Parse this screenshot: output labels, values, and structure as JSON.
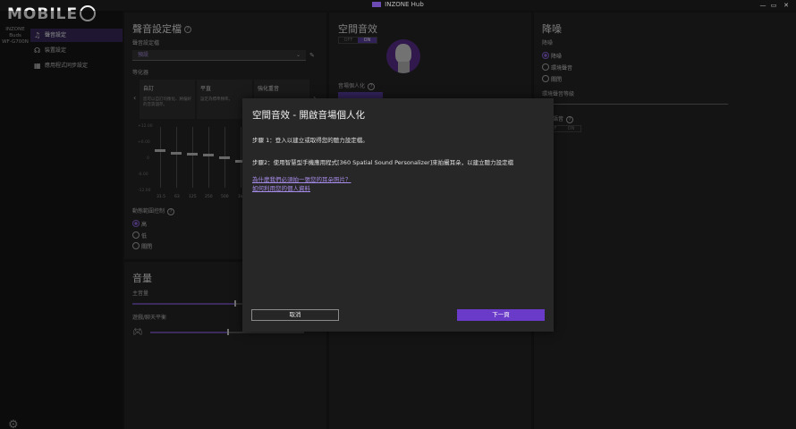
{
  "watermark": {
    "text": "MOBILE"
  },
  "titlebar": {
    "app_name": "INZONE Hub",
    "min": "—",
    "max": "▭",
    "close": "✕"
  },
  "sidebar": {
    "device_line1": "INZONE Buds",
    "device_line2": "WF-G700N",
    "items": [
      {
        "label": "聲音設定",
        "icon": "♫"
      },
      {
        "label": "裝置設定",
        "icon": "☊"
      },
      {
        "label": "應用程式同步設定",
        "icon": "▦"
      }
    ],
    "settings_icon": "⚙"
  },
  "sound": {
    "title": "聲音設定檔",
    "profile_label": "聲音設定檔",
    "profile_value": "預設",
    "eq_label": "等化器",
    "cards": [
      {
        "title": "自訂",
        "desc": "您可以自訂均衡化、將偏好的音質儲存。"
      },
      {
        "title": "平直",
        "desc": "設定為標準頻率。"
      },
      {
        "title": "強化重音",
        "desc": ""
      }
    ],
    "axis": [
      "+12.00",
      "+6.00",
      "0",
      "-6.00",
      "-12.00"
    ],
    "freqs": [
      "31.5",
      "63",
      "125",
      "250",
      "500",
      "1k"
    ],
    "dynamic_label": "動態範圍控制",
    "dynamic_options": [
      "高",
      "低",
      "關閉"
    ],
    "dynamic_selected": 0
  },
  "volume": {
    "title": "音量",
    "master_label": "主音量",
    "balance_label": "遊戲/聊天平衡",
    "master_level_pct": 55,
    "balance_level_pct": 50
  },
  "spatial": {
    "title": "空間音效",
    "off": "OFF",
    "on": "ON",
    "personalize_label": "音場個人化"
  },
  "nc": {
    "title": "降噪",
    "label": "降噪",
    "options": [
      "降噪",
      "環境聲音",
      "關閉"
    ],
    "selected": 0,
    "ambient_label": "環境聲音等級",
    "focus_label": "對話語音",
    "off": "OFF",
    "on": "ON"
  },
  "modal": {
    "title": "空間音效 - 開啟音場個人化",
    "step1": "步驟 1：登入以建立或取得您的聽力設定檔。",
    "step2": "步驟2：使用智慧型手機應用程式[360 Spatial Sound Personalizer]來拍攝耳朵，以建立聽力設定檔",
    "link1": "為什麼我們必須拍一張您的耳朵照片？",
    "link2": "如何利用您的個人資料",
    "cancel": "取消",
    "next": "下一頁"
  }
}
